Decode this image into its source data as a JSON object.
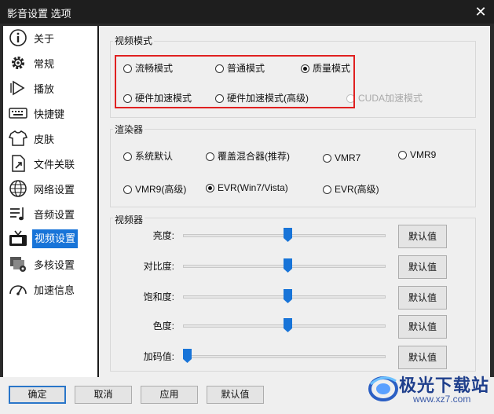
{
  "window": {
    "title": "影音设置 选项",
    "close_glyph": "✕"
  },
  "sidebar": {
    "items": [
      {
        "label": "关于",
        "icon": "info-icon"
      },
      {
        "label": "常规",
        "icon": "gear-icon"
      },
      {
        "label": "播放",
        "icon": "play-icon"
      },
      {
        "label": "快捷键",
        "icon": "keyboard-icon"
      },
      {
        "label": "皮肤",
        "icon": "shirt-icon"
      },
      {
        "label": "文件关联",
        "icon": "file-link-icon"
      },
      {
        "label": "网络设置",
        "icon": "network-icon"
      },
      {
        "label": "音频设置",
        "icon": "audio-icon"
      },
      {
        "label": "视频设置",
        "icon": "tv-icon",
        "active": true
      },
      {
        "label": "多核设置",
        "icon": "multicore-icon"
      },
      {
        "label": "加速信息",
        "icon": "gauge-icon"
      }
    ]
  },
  "video_mode": {
    "title": "视频模式",
    "options": [
      {
        "label": "流畅模式",
        "checked": false,
        "disabled": false
      },
      {
        "label": "普通模式",
        "checked": false,
        "disabled": false
      },
      {
        "label": "质量模式",
        "checked": true,
        "disabled": false
      },
      {
        "label": "硬件加速模式",
        "checked": false,
        "disabled": false
      },
      {
        "label": "硬件加速模式(高级)",
        "checked": false,
        "disabled": false
      },
      {
        "label": "CUDA加速模式",
        "checked": false,
        "disabled": true
      }
    ]
  },
  "renderer": {
    "title": "渲染器",
    "options": [
      {
        "label": "系统默认",
        "checked": false
      },
      {
        "label": "覆盖混合器(推荐)",
        "checked": false
      },
      {
        "label": "VMR7",
        "checked": false
      },
      {
        "label": "VMR9",
        "checked": false
      },
      {
        "label": "VMR9(高级)",
        "checked": false
      },
      {
        "label": "EVR(Win7/Vista)",
        "checked": true
      },
      {
        "label": "EVR(高级)",
        "checked": false
      }
    ]
  },
  "video_adjust": {
    "title": "视频器",
    "default_label": "默认值",
    "sliders": [
      {
        "label": "亮度:",
        "value": 0.5
      },
      {
        "label": "对比度:",
        "value": 0.5
      },
      {
        "label": "饱和度:",
        "value": 0.5
      },
      {
        "label": "色度:",
        "value": 0.5
      },
      {
        "label": "加码值:",
        "value": 0.0
      }
    ]
  },
  "footer": {
    "ok": "确定",
    "cancel": "取消",
    "apply": "应用",
    "default": "默认值"
  },
  "watermark": {
    "brand": "极光下载站",
    "url": "www.xz7.com"
  },
  "colors": {
    "accent": "#1874d8",
    "highlight_border": "#e02020",
    "slider_thumb": "#1874d8"
  }
}
